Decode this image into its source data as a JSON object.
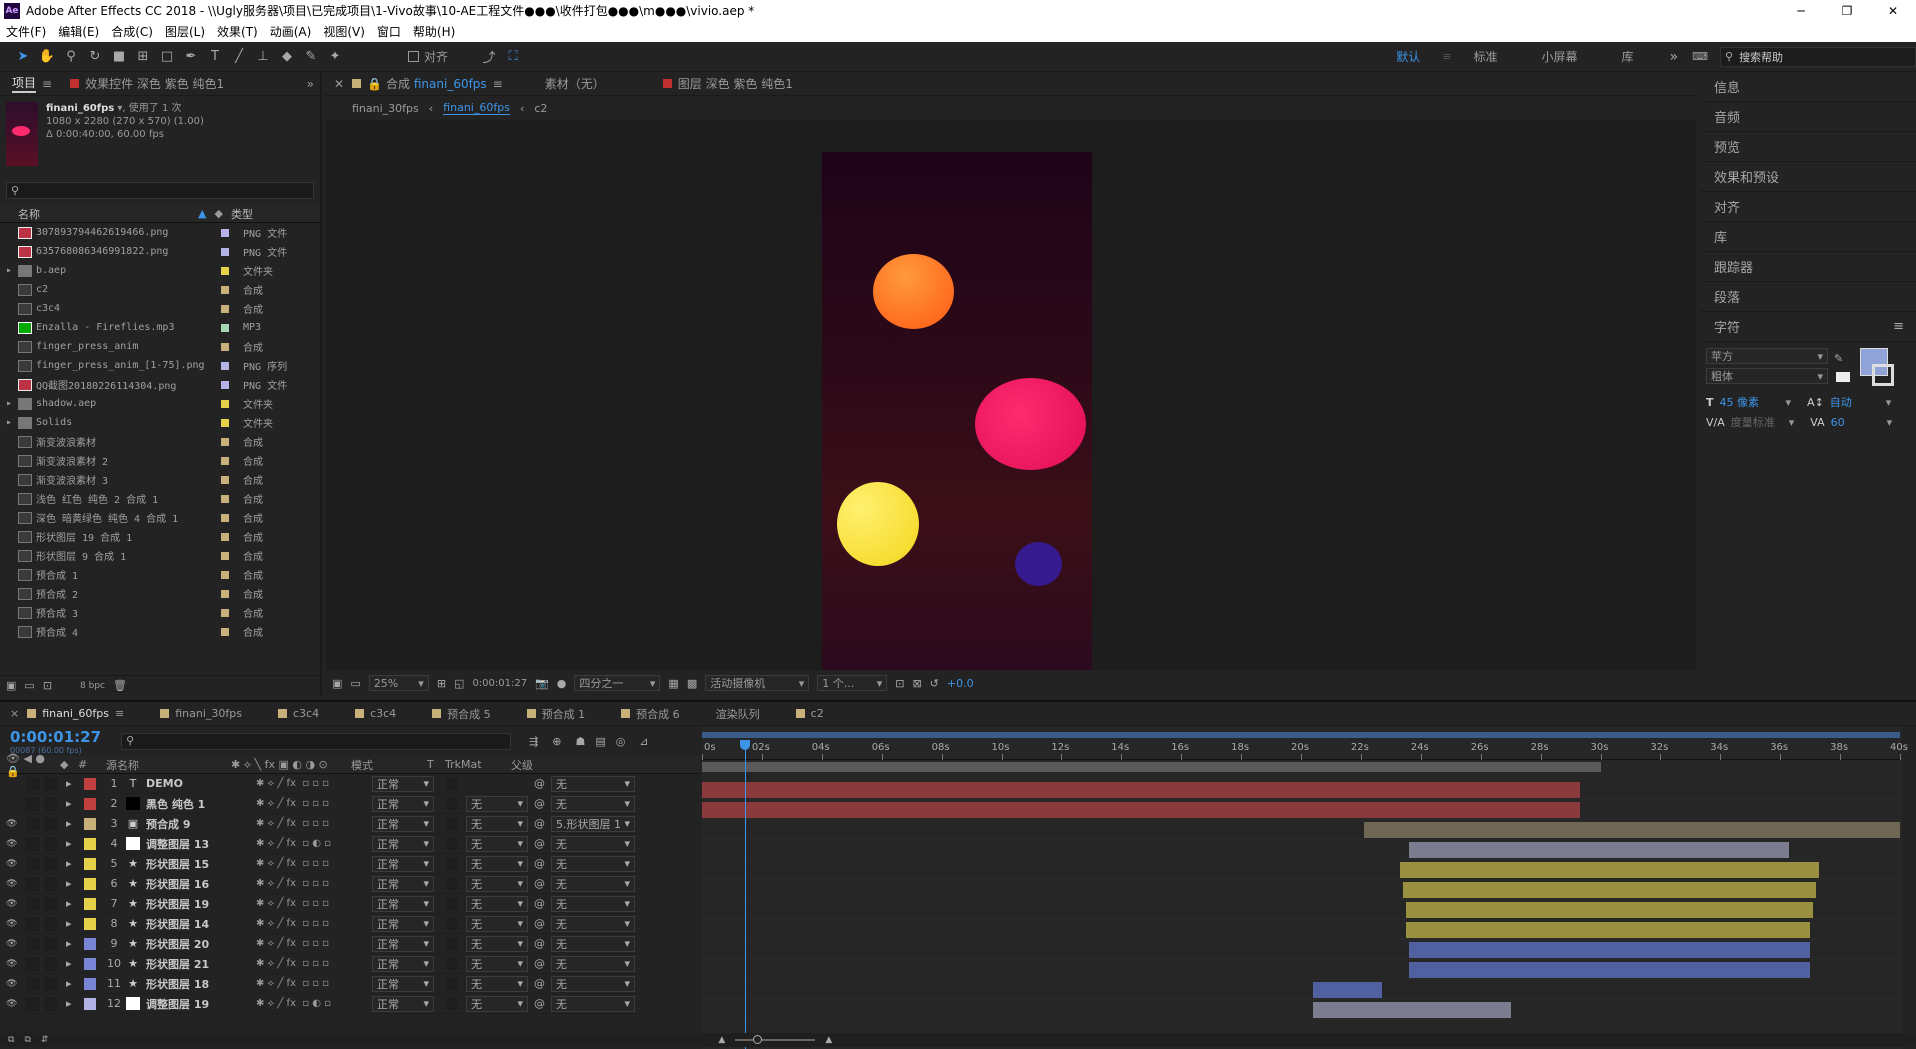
{
  "app": {
    "title": "Adobe After Effects CC 2018 - \\\\Ugly服务器\\项目\\已完成项目\\1-Vivo故事\\10-AE工程文件●●●\\收件打包●●●\\m●●●\\vivio.aep *",
    "icon": "Ae"
  },
  "menu": [
    "文件(F)",
    "编辑(E)",
    "合成(C)",
    "图层(L)",
    "效果(T)",
    "动画(A)",
    "视图(V)",
    "窗口",
    "帮助(H)"
  ],
  "toolbar": {
    "align_label": "对齐",
    "workspaces": [
      "默认",
      "标准",
      "小屏幕",
      "库"
    ],
    "active_workspace": "默认",
    "search_placeholder": "搜索帮助"
  },
  "project": {
    "tab": "项目",
    "effects_tab": "效果控件 深色 紫色 纯色1",
    "selected_name": "finani_60fps",
    "usage": ", 使用了 1 次",
    "dims": "1080 x 2280 (270 x 570) (1.00)",
    "duration": "Δ 0:00:40:00, 60.00 fps",
    "col_name": "名称",
    "col_type": "类型",
    "bpc": "8 bpc",
    "items": [
      {
        "name": "307893794462619466.png",
        "type": "PNG 文件",
        "color": "#b3b3e6",
        "kind": "img"
      },
      {
        "name": "635768086346991822.png",
        "type": "PNG 文件",
        "color": "#b3b3e6",
        "kind": "img"
      },
      {
        "name": "b.aep",
        "type": "文件夹",
        "color": "#e5d14a",
        "kind": "folder"
      },
      {
        "name": "c2",
        "type": "合成",
        "color": "#c7b07a",
        "kind": "comp"
      },
      {
        "name": "c3c4",
        "type": "合成",
        "color": "#c7b07a",
        "kind": "comp"
      },
      {
        "name": "Enzalla - Fireflies.mp3",
        "type": "MP3",
        "color": "#a8d6b4",
        "kind": "audio"
      },
      {
        "name": "finger_press_anim",
        "type": "合成",
        "color": "#c7b07a",
        "kind": "comp"
      },
      {
        "name": "finger_press_anim_[1-75].png",
        "type": "PNG 序列",
        "color": "#b3b3e6",
        "kind": "seq"
      },
      {
        "name": "QQ截图20180226114304.png",
        "type": "PNG 文件",
        "color": "#b3b3e6",
        "kind": "img"
      },
      {
        "name": "shadow.aep",
        "type": "文件夹",
        "color": "#e5d14a",
        "kind": "folder"
      },
      {
        "name": "Solids",
        "type": "文件夹",
        "color": "#e5d14a",
        "kind": "folder"
      },
      {
        "name": "渐变波浪素材",
        "type": "合成",
        "color": "#c7b07a",
        "kind": "comp"
      },
      {
        "name": "渐变波浪素材 2",
        "type": "合成",
        "color": "#c7b07a",
        "kind": "comp"
      },
      {
        "name": "渐变波浪素材 3",
        "type": "合成",
        "color": "#c7b07a",
        "kind": "comp"
      },
      {
        "name": "浅色 红色 纯色 2 合成 1",
        "type": "合成",
        "color": "#c7b07a",
        "kind": "comp"
      },
      {
        "name": "深色 暗黄绿色 纯色 4 合成 1",
        "type": "合成",
        "color": "#c7b07a",
        "kind": "comp"
      },
      {
        "name": "形状图层 19 合成 1",
        "type": "合成",
        "color": "#c7b07a",
        "kind": "comp"
      },
      {
        "name": "形状图层 9 合成 1",
        "type": "合成",
        "color": "#c7b07a",
        "kind": "comp"
      },
      {
        "name": "预合成 1",
        "type": "合成",
        "color": "#c7b07a",
        "kind": "comp"
      },
      {
        "name": "预合成 2",
        "type": "合成",
        "color": "#c7b07a",
        "kind": "comp"
      },
      {
        "name": "预合成 3",
        "type": "合成",
        "color": "#c7b07a",
        "kind": "comp"
      },
      {
        "name": "预合成 4",
        "type": "合成",
        "color": "#c7b07a",
        "kind": "comp"
      }
    ]
  },
  "comp": {
    "tab_prefix": "合成",
    "tab_name": "finani_60fps",
    "footage_tab": "素材（无）",
    "layer_tab": "图层 深色 紫色 纯色1",
    "crumbs": [
      "finani_30fps",
      "finani_60fps",
      "c2"
    ],
    "zoom": "25%",
    "time": "0:00:01:27",
    "resolution": "四分之一",
    "camera": "活动摄像机",
    "views": "1 个...",
    "exposure": "+0.0"
  },
  "right": {
    "panels": [
      "信息",
      "音频",
      "预览",
      "效果和预设",
      "对齐",
      "库",
      "跟踪器",
      "段落"
    ],
    "char_title": "字符",
    "font": "苹方",
    "style": "粗体",
    "size": "45 像素",
    "leading": "自动",
    "kern": "度量标准",
    "track": "60",
    "fill": "#8fa3d8"
  },
  "timeline": {
    "tabs": [
      "finani_60fps",
      "finani_30fps",
      "c3c4",
      "c3c4",
      "预合成 5",
      "预合成 1",
      "预合成 6",
      "渲染队列",
      "c2"
    ],
    "tab_colors": [
      "#c7b07a",
      "#c7b07a",
      "#c7b07a",
      "#c7b07a",
      "#c7b07a",
      "#c7b07a",
      "#c7b07a",
      "",
      "#c7b07a"
    ],
    "timecode": "0:00:01:27",
    "frames": "00087 (60.00 fps)",
    "col_source": "源名称",
    "col_mode": "模式",
    "col_t": "T",
    "col_trk": "TrkMat",
    "col_parent": "父级",
    "ruler": [
      "0s",
      "02s",
      "04s",
      "06s",
      "08s",
      "10s",
      "12s",
      "14s",
      "16s",
      "18s",
      "20s",
      "22s",
      "24s",
      "26s",
      "28s",
      "30s",
      "32s",
      "34s",
      "36s",
      "38s",
      "40s"
    ],
    "current_time_s": 1.45,
    "work_area_s": [
      0,
      30
    ],
    "duration_s": 40,
    "layers": [
      {
        "n": "1",
        "name": "DEMO",
        "color": "#c04040",
        "kind": "T",
        "mode": "正常",
        "trk": "",
        "parent": "无",
        "start": 0,
        "end": 29.3,
        "bar": "#8a3a3d"
      },
      {
        "n": "2",
        "name": "黑色 纯色 1",
        "color": "#c04040",
        "kind": "solid",
        "mode": "正常",
        "trk": "无",
        "parent": "无",
        "start": 0,
        "end": 29.3,
        "bar": "#8a3a3d"
      },
      {
        "n": "3",
        "name": "预合成 9",
        "color": "#c7b07a",
        "kind": "comp",
        "mode": "正常",
        "trk": "无",
        "parent": "5.形状图层 1",
        "start": 22.1,
        "end": 40,
        "bar": "#6f6656"
      },
      {
        "n": "4",
        "name": "调整图层 13",
        "color": "#e5d14a",
        "kind": "adj",
        "mode": "正常",
        "trk": "无",
        "parent": "无",
        "start": 23.6,
        "end": 36.3,
        "bar": "#7c7c90"
      },
      {
        "n": "5",
        "name": "形状图层 15",
        "color": "#e5d14a",
        "kind": "shape",
        "mode": "正常",
        "trk": "无",
        "parent": "无",
        "start": 23.3,
        "end": 37.3,
        "bar": "#9a9140"
      },
      {
        "n": "6",
        "name": "形状图层 16",
        "color": "#e5d14a",
        "kind": "shape",
        "mode": "正常",
        "trk": "无",
        "parent": "无",
        "start": 23.4,
        "end": 37.2,
        "bar": "#9a9140"
      },
      {
        "n": "7",
        "name": "形状图层 19",
        "color": "#e5d14a",
        "kind": "shape",
        "mode": "正常",
        "trk": "无",
        "parent": "无",
        "start": 23.5,
        "end": 37.1,
        "bar": "#9a9140"
      },
      {
        "n": "8",
        "name": "形状图层 14",
        "color": "#e5d14a",
        "kind": "shape",
        "mode": "正常",
        "trk": "无",
        "parent": "无",
        "start": 23.5,
        "end": 37.0,
        "bar": "#9a9140"
      },
      {
        "n": "9",
        "name": "形状图层 20",
        "color": "#7b85d8",
        "kind": "shape",
        "mode": "正常",
        "trk": "无",
        "parent": "无",
        "start": 23.6,
        "end": 37.0,
        "bar": "#5160a0"
      },
      {
        "n": "10",
        "name": "形状图层 21",
        "color": "#7b85d8",
        "kind": "shape",
        "mode": "正常",
        "trk": "无",
        "parent": "无",
        "start": 23.6,
        "end": 37.0,
        "bar": "#5160a0"
      },
      {
        "n": "11",
        "name": "形状图层 18",
        "color": "#7b85d8",
        "kind": "shape",
        "mode": "正常",
        "trk": "无",
        "parent": "无",
        "start": 20.4,
        "end": 22.7,
        "bar": "#5160a0"
      },
      {
        "n": "12",
        "name": "调整图层 19",
        "color": "#b3b3e6",
        "kind": "adj",
        "mode": "正常",
        "trk": "无",
        "parent": "无",
        "start": 20.4,
        "end": 27.0,
        "bar": "#7c7c90"
      }
    ]
  }
}
